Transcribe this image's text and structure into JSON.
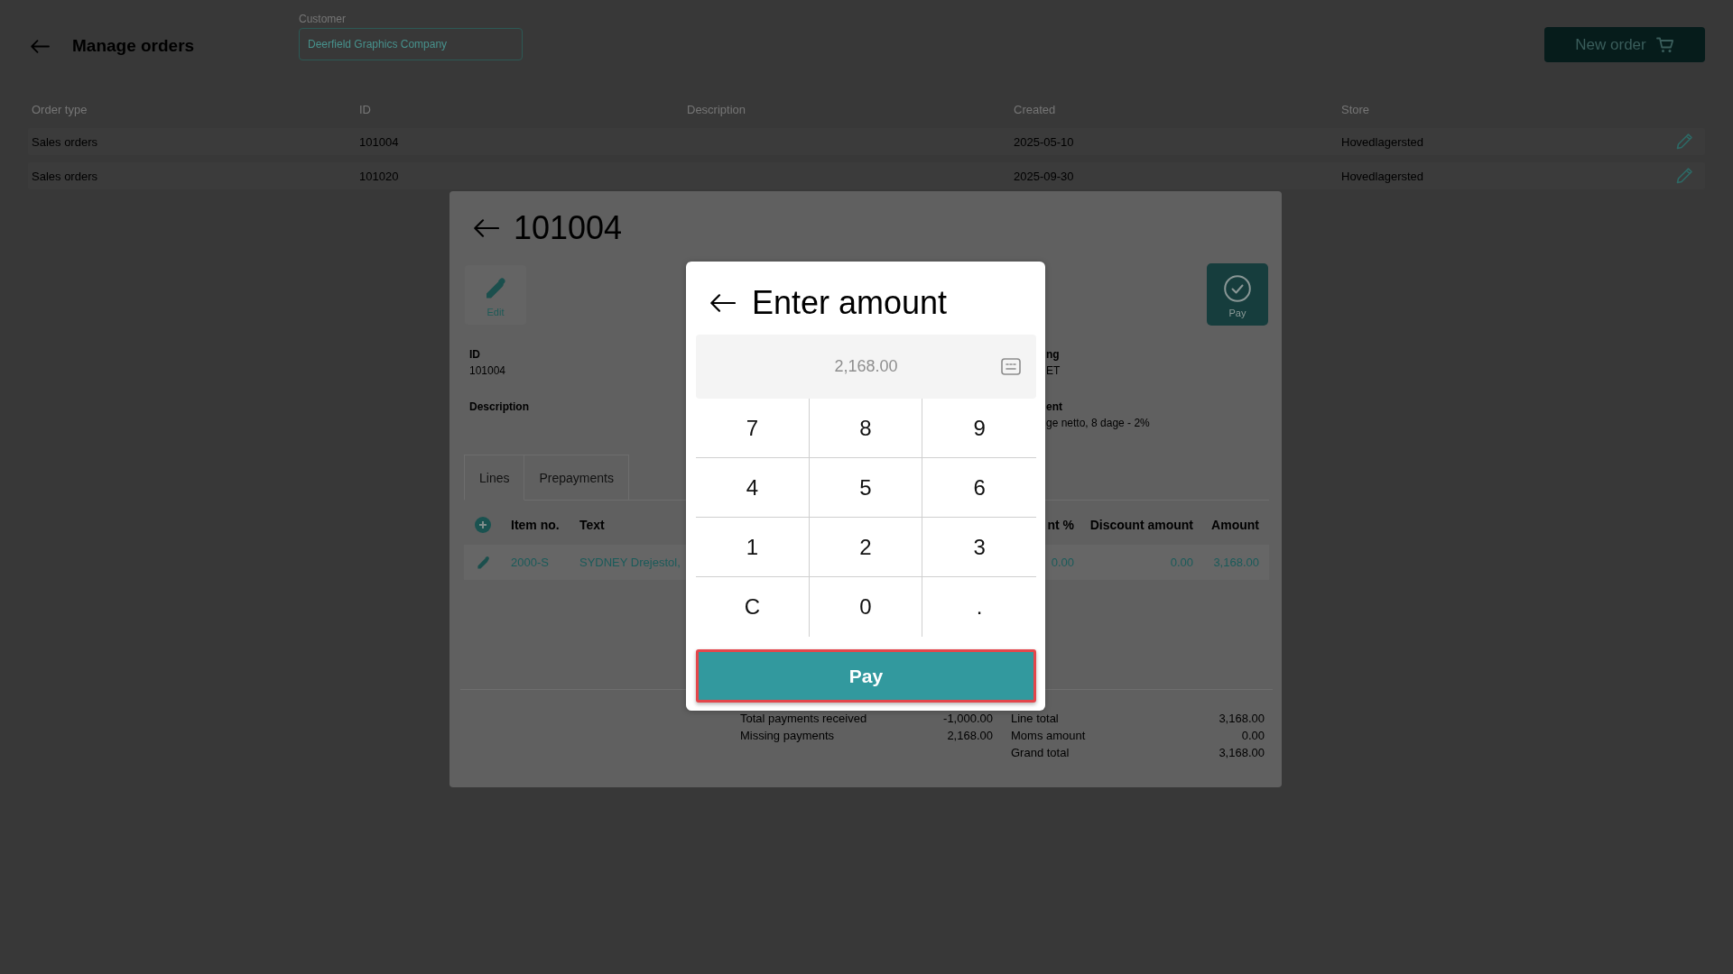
{
  "header": {
    "title": "Manage orders",
    "customer": {
      "label": "Customer",
      "value": "Deerfield Graphics Company"
    },
    "new_order_button": "New order"
  },
  "orders_table": {
    "columns": [
      "Order type",
      "ID",
      "Description",
      "Created",
      "Store"
    ],
    "rows": [
      {
        "order_type": "Sales orders",
        "id": "101004",
        "created": "2025-05-10",
        "store": "Hovedlagersted"
      },
      {
        "order_type": "Sales orders",
        "id": "101020",
        "created": "2025-09-30",
        "store": "Hovedlagersted"
      }
    ]
  },
  "order_dialog": {
    "title": "101004",
    "actions": [
      {
        "kind": "edit",
        "label": "Edit"
      },
      {
        "kind": "pay",
        "label": "Pay"
      }
    ],
    "fields": [
      {
        "label": "ID",
        "value": "101004"
      },
      {
        "label": "ng",
        "value": "ET"
      },
      {
        "label": "Description"
      },
      {
        "label": "ent",
        "value": "ge netto, 8 dage - 2%"
      }
    ],
    "tabs": [
      {
        "label": "Lines",
        "selected": true
      },
      {
        "label": "Prepayments",
        "selected": false
      }
    ],
    "lines_table": {
      "columns": [
        "Item no.",
        "Text",
        "nt %",
        "Discount amount",
        "Amount"
      ],
      "rows": [
        {
          "item_no": "2000-S",
          "text": "SYDNEY Drejestol,",
          "discount_percent": "0.00",
          "discount_amount": "0.00",
          "amount": "3,168.00"
        }
      ]
    },
    "payment_summary": [
      {
        "label": "Total payments received",
        "value": "-1,000.00"
      },
      {
        "label": "Missing payments",
        "value": "2,168.00"
      }
    ],
    "order_totals": [
      {
        "label": "Line total",
        "value": "3,168.00"
      },
      {
        "label": "Moms amount",
        "value": "0.00"
      },
      {
        "label": "Grand total",
        "value": "3,168.00"
      }
    ]
  },
  "amount_dialog": {
    "title": "Enter amount",
    "amount_field": {
      "placeholder": "2,168.00"
    },
    "keys": [
      "7",
      "8",
      "9",
      "4",
      "5",
      "6",
      "1",
      "2",
      "3",
      "C",
      "0",
      "."
    ],
    "pay_button": "Pay"
  }
}
